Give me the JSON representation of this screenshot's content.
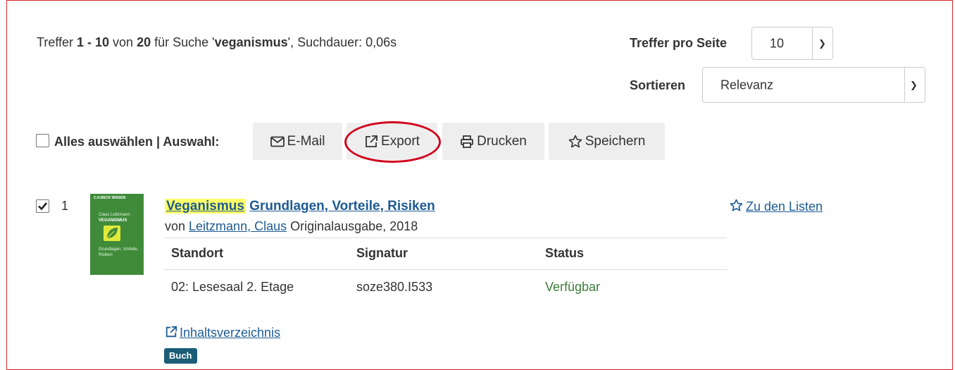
{
  "results": {
    "prefix": "Treffer ",
    "range": "1 - 10",
    "of_label": " von ",
    "total": "20",
    "search_label": " für Suche '",
    "query": "veganismus",
    "duration_label": "', Suchdauer: 0,06s"
  },
  "per_page": {
    "label": "Treffer pro Seite",
    "value": "10"
  },
  "sort": {
    "label": "Sortieren",
    "value": "Relevanz"
  },
  "selection": {
    "select_all_label": "Alles auswählen | Auswahl:",
    "email_label": "E-Mail",
    "export_label": "Export",
    "print_label": "Drucken",
    "save_label": "Speichern"
  },
  "record": {
    "index": "1",
    "checked": true,
    "cover": {
      "brand": "C.H.BECK WISSEN",
      "author": "Claus Leitzmann",
      "title": "VEGANISMUS",
      "subtitle": "Grundlagen, Vorteile, Risiken"
    },
    "title_main": "Veganismus",
    "title_sub": "Grundlagen, Vorteile, Risiken",
    "by_label": "von ",
    "author": "Leitzmann, Claus",
    "edition": " Originalausgabe, 2018",
    "holdings": {
      "headers": [
        "Standort",
        "Signatur",
        "Status"
      ],
      "rows": [
        [
          "02: Lesesaal 2. Etage",
          "soze380.I533",
          "Verfügbar"
        ]
      ]
    },
    "toc_link": "Inhaltsverzeichnis",
    "format_badge": "Buch",
    "lists_link": "Zu den Listen"
  },
  "colors": {
    "frame": "#d9262a",
    "link": "#1d5b92",
    "available": "#3c7d3a",
    "badge": "#1b5d77",
    "highlight": "#ffff66",
    "ellipse": "#d0021b"
  }
}
